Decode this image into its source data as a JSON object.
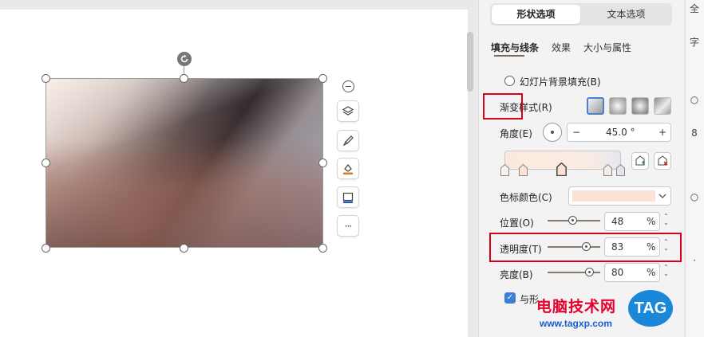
{
  "panel": {
    "mode_tabs": [
      "形状选项",
      "文本选项"
    ],
    "sub_tabs": [
      "填充与线条",
      "效果",
      "大小与属性"
    ],
    "slide_bg_fill_label": "幻灯片背景填充(B)",
    "gradient_style_label": "渐变样式(R)",
    "angle_label": "角度(E)",
    "angle_value": "45.0 °",
    "stop_color_label": "色标颜色(C)",
    "position_label": "位置(O)",
    "position_value": "48",
    "transparency_label": "透明度(T)",
    "transparency_value": "83",
    "brightness_label": "亮度(B)",
    "brightness_value": "80",
    "percent": "%",
    "rotate_with_shape_label": "与形",
    "minus": "−",
    "plus": "+",
    "stop_color": "#fbe1d6",
    "slider_levels": {
      "position": 0.48,
      "transparency": 0.83,
      "brightness": 0.8
    }
  },
  "floatbar": {
    "collapse": "−",
    "icons": [
      "layers-icon",
      "brush-icon",
      "fill-icon",
      "border-icon",
      "more-icon"
    ],
    "more": "···"
  },
  "edge": [
    "全",
    "字",
    "○",
    "8",
    "○",
    "·"
  ],
  "watermark": {
    "site_name": "电脑技术网",
    "url": "www.tagxp.com",
    "logo": "TAG"
  },
  "colors": {
    "accent": "#3d7fd6",
    "highlight": "#d9001b",
    "tab_underline": "#7a6a58"
  }
}
